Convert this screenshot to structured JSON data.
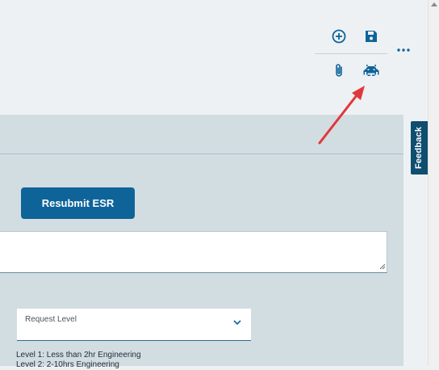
{
  "toolbar": {
    "add_icon": "plus-circle-icon",
    "save_icon": "floppy-disk-icon",
    "more_icon": "more-horizontal-icon",
    "attach_icon": "paperclip-icon",
    "debug_icon": "space-invader-icon"
  },
  "form": {
    "resubmit_label": "Resubmit ESR",
    "request_level_label": "Request Level",
    "levels": [
      "Level 1: Less than 2hr Engineering",
      "Level 2: 2-10hrs Engineering"
    ]
  },
  "feedback_tab": {
    "label": "Feedback"
  },
  "colors": {
    "accent": "#0e6499",
    "icon": "#0e6499",
    "annotation_arrow": "#e0383b",
    "panel_bg": "#d2dde2"
  }
}
